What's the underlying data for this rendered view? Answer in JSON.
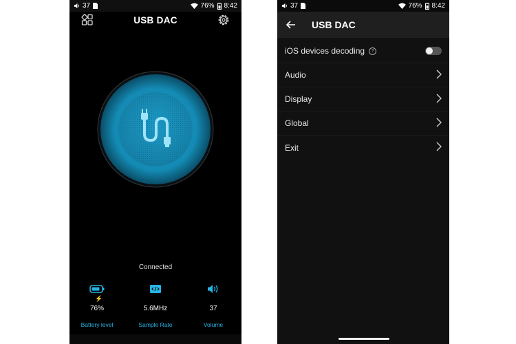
{
  "left": {
    "status": {
      "notif_count": "37",
      "battery": "76%",
      "time": "8:42"
    },
    "title": "USB DAC",
    "state": "Connected",
    "stats": {
      "battery": {
        "value": "76%",
        "label": "Battery level"
      },
      "sample_rate": {
        "value": "5.6MHz",
        "label": "Sample Rate"
      },
      "volume": {
        "value": "37",
        "label": "Volume"
      }
    }
  },
  "right": {
    "status": {
      "notif_count": "37",
      "battery": "76%",
      "time": "8:42"
    },
    "title": "USB DAC",
    "items": [
      {
        "label": "iOS devices decoding",
        "control": "toggle",
        "on": false
      },
      {
        "label": "Audio",
        "control": "chevron"
      },
      {
        "label": "Display",
        "control": "chevron"
      },
      {
        "label": "Global",
        "control": "chevron"
      },
      {
        "label": "Exit",
        "control": "chevron"
      }
    ]
  },
  "colors": {
    "accent": "#27b3e6",
    "orb": "#1aa3cf",
    "background": "#000000"
  },
  "icons": [
    "volume-icon",
    "sim-icon",
    "wifi-icon",
    "battery-icon",
    "apps-grid-icon",
    "gear-icon",
    "usb-cable-icon",
    "lightning-icon",
    "chip-icon",
    "back-arrow-icon",
    "chevron-right-icon",
    "help-icon"
  ]
}
